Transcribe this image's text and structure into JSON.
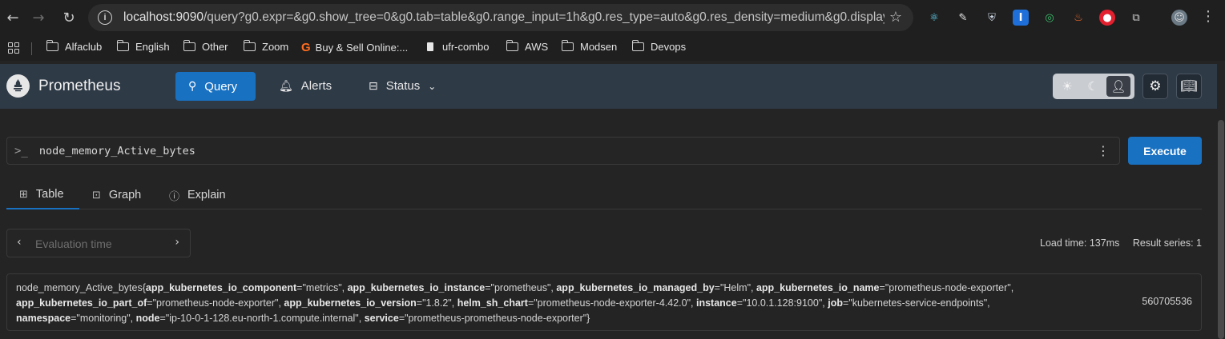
{
  "browser": {
    "url_host": "localhost:9090",
    "url_path": "/query?g0.expr=&g0.show_tree=0&g0.tab=table&g0.range_input=1h&g0.res_type=auto&g0.res_density=medium&g0.display..."
  },
  "bookmarks": [
    {
      "label": "Alfaclub",
      "icon": "folder-icon"
    },
    {
      "label": "English",
      "icon": "folder-icon"
    },
    {
      "label": "Other",
      "icon": "folder-icon"
    },
    {
      "label": "Zoom",
      "icon": "folder-icon"
    },
    {
      "label": "Buy & Sell Online:...",
      "icon": "g-logo-icon"
    },
    {
      "label": "ufr-combo",
      "icon": "page-icon"
    },
    {
      "label": "AWS",
      "icon": "folder-icon"
    },
    {
      "label": "Modsen",
      "icon": "folder-icon"
    },
    {
      "label": "Devops",
      "icon": "folder-icon"
    }
  ],
  "app": {
    "brand": "Prometheus",
    "nav": {
      "query": "Query",
      "alerts": "Alerts",
      "status": "Status"
    },
    "accent_color": "#1971c2",
    "header_color": "#2f3a47"
  },
  "query": {
    "expression": "node_memory_Active_bytes",
    "execute_label": "Execute"
  },
  "tabs": {
    "table": "Table",
    "graph": "Graph",
    "explain": "Explain",
    "active": "Table"
  },
  "eval": {
    "placeholder": "Evaluation time"
  },
  "stats": {
    "load_time": "Load time: 137ms",
    "result_series": "Result series: 1"
  },
  "result": {
    "metric": "node_memory_Active_bytes",
    "labels": [
      {
        "key": "app_kubernetes_io_component",
        "value": "\"metrics\""
      },
      {
        "key": "app_kubernetes_io_instance",
        "value": "\"prometheus\""
      },
      {
        "key": "app_kubernetes_io_managed_by",
        "value": "\"Helm\""
      },
      {
        "key": "app_kubernetes_io_name",
        "value": "\"prometheus-node-exporter\""
      },
      {
        "key": "app_kubernetes_io_part_of",
        "value": "\"prometheus-node-exporter\""
      },
      {
        "key": "app_kubernetes_io_version",
        "value": "\"1.8.2\""
      },
      {
        "key": "helm_sh_chart",
        "value": "\"prometheus-node-exporter-4.42.0\""
      },
      {
        "key": "instance",
        "value": "\"10.0.1.128:9100\""
      },
      {
        "key": "job",
        "value": "\"kubernetes-service-endpoints\""
      },
      {
        "key": "namespace",
        "value": "\"monitoring\""
      },
      {
        "key": "node",
        "value": "\"ip-10-0-1-128.eu-north-1.compute.internal\""
      },
      {
        "key": "service",
        "value": "\"prometheus-prometheus-node-exporter\""
      }
    ],
    "value": "560705536"
  }
}
